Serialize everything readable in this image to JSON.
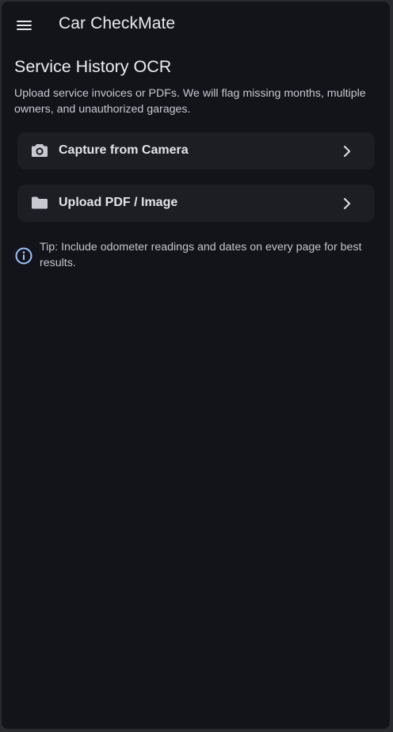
{
  "appbar": {
    "menu_icon": "menu-icon",
    "title": "Car CheckMate"
  },
  "main": {
    "title": "Service History OCR",
    "description": "Upload service invoices or PDFs. We will flag missing months, multiple owners, and unauthorized garages.",
    "actions": [
      {
        "label": "Capture from Camera",
        "icon": "camera-icon",
        "trailing_icon": "chevron-right-icon"
      },
      {
        "label": "Upload PDF / Image",
        "icon": "folder-icon",
        "trailing_icon": "chevron-right-icon"
      }
    ],
    "tip": {
      "icon": "info-icon",
      "text": "Tip: Include odometer readings and dates on every page for best results."
    }
  },
  "colors": {
    "background": "#131419",
    "card": "#1d1e23",
    "text_primary": "#ececf1",
    "text_secondary": "#c8c9d0",
    "info_accent": "#9ec3ff"
  }
}
